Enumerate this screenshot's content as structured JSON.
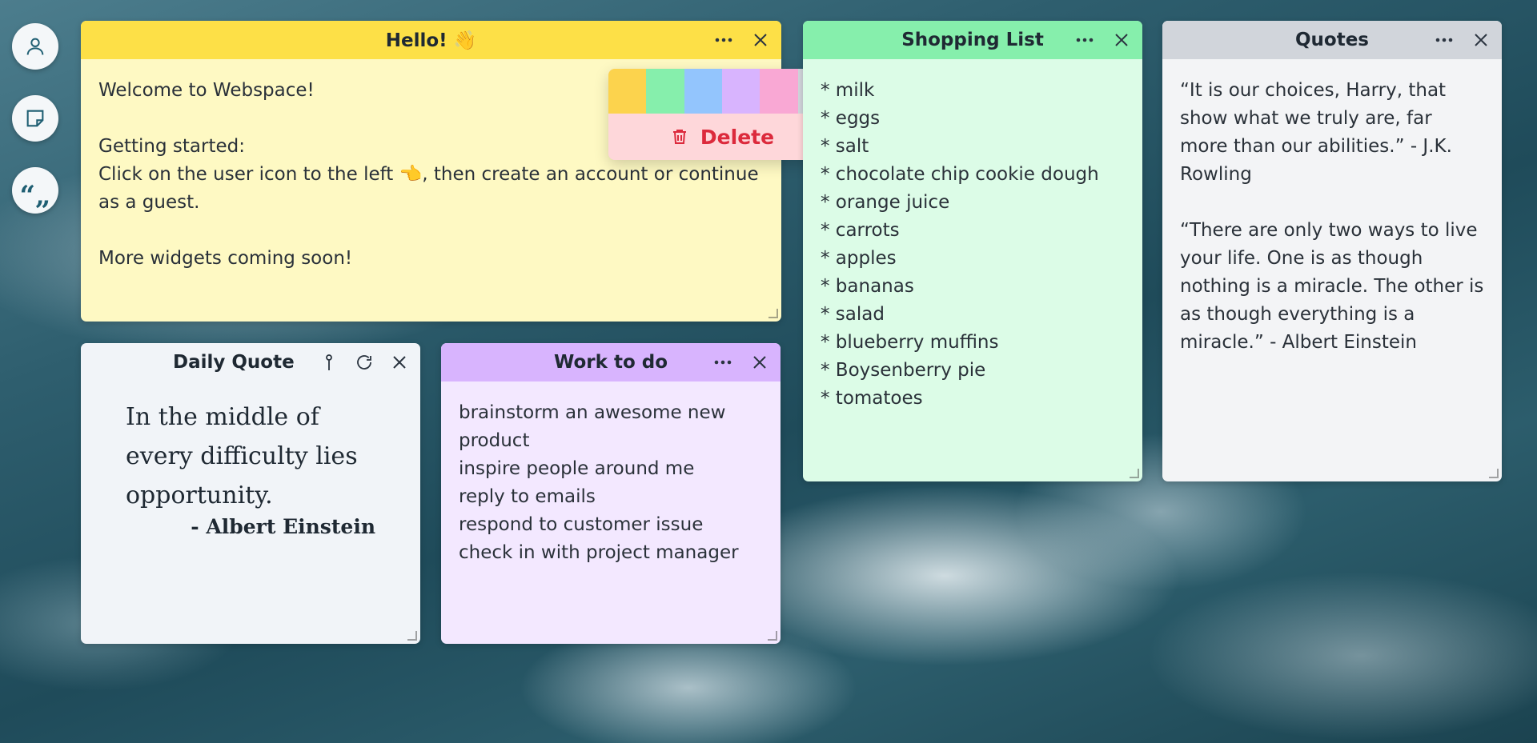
{
  "rail": {
    "items": [
      {
        "icon": "user-icon"
      },
      {
        "icon": "sticky-note-icon"
      },
      {
        "icon": "quote-icon",
        "glyph": "“„"
      }
    ]
  },
  "hello": {
    "title": "Hello! 👋",
    "body": "Welcome to Webspace!\n\nGetting started:\nClick on the user icon to the left 👈, then create an account or continue as a guest.\n\nMore widgets coming soon!",
    "color": "#fde047"
  },
  "popup": {
    "swatches": [
      "#fcd34d",
      "#86efac",
      "#93c5fd",
      "#d8b4fe",
      "#f9a8d4",
      "#d1d5db"
    ],
    "delete_label": "Delete"
  },
  "shopping": {
    "title": "Shopping List",
    "body": "* milk\n* eggs\n* salt\n* chocolate chip cookie dough\n* orange juice\n* carrots\n* apples\n* bananas\n* salad\n* blueberry muffins\n* Boysenberry pie\n* tomatoes",
    "color": "#86efac"
  },
  "quotes": {
    "title": "Quotes",
    "body": "“It is our choices, Harry, that show what we truly are, far more than our abilities.” - J.K. Rowling\n\n“There are only two ways to live your life. One is as though nothing is a miracle. The other is as though everything is a miracle.” - Albert Einstein",
    "color": "#d1d5db"
  },
  "daily": {
    "title": "Daily Quote",
    "quote": "In the middle of every difficulty lies opportunity.",
    "author": "- Albert Einstein"
  },
  "work": {
    "title": "Work to do",
    "body": "brainstorm an awesome new product\ninspire people around me\nreply to emails\nrespond to customer issue\ncheck in with project manager",
    "color": "#d8b4fe"
  }
}
